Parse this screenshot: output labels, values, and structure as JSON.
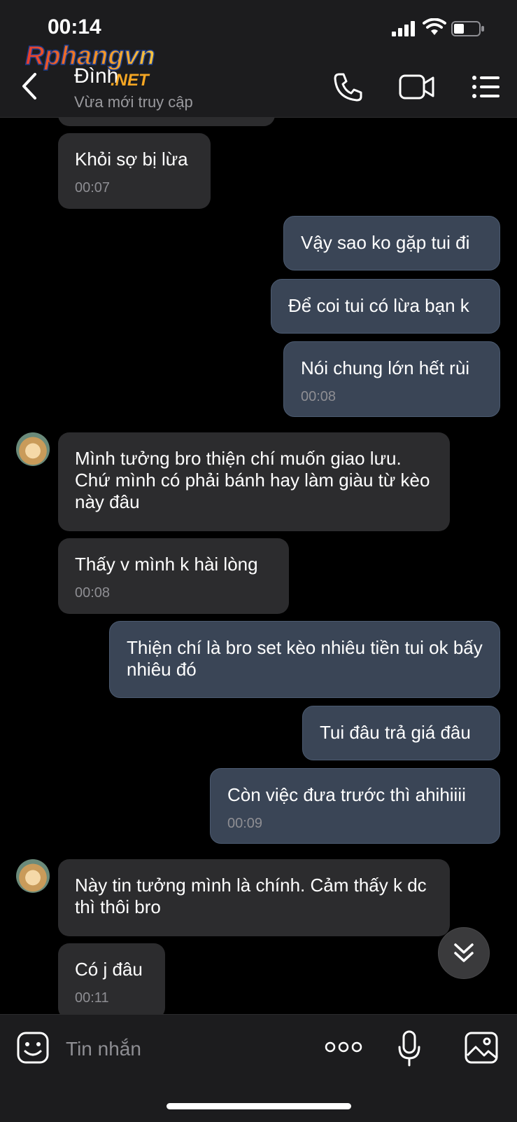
{
  "status_bar": {
    "time": "00:14"
  },
  "header": {
    "contact_name": "Đình",
    "contact_status": "Vừa mới truy cập",
    "watermark_text": "Rphangvn.NET"
  },
  "messages": [
    {
      "side": "in",
      "text": "Khỏi sợ bị lừa",
      "time": "00:07"
    },
    {
      "side": "out",
      "text": "Vậy sao ko gặp tui đi"
    },
    {
      "side": "out",
      "text": "Để coi tui có lừa bạn k"
    },
    {
      "side": "out",
      "text": "Nói chung lớn hết rùi",
      "time": "00:08"
    },
    {
      "side": "in",
      "text": "Mình tưởng bro thiện chí muốn giao lưu. Chứ mình có phải bánh hay làm giàu từ kèo này đâu"
    },
    {
      "side": "in",
      "text": "Thấy v mình k hài lòng",
      "time": "00:08"
    },
    {
      "side": "out",
      "text": "Thiện chí là bro set kèo nhiêu tiền tui ok bấy nhiêu đó"
    },
    {
      "side": "out",
      "text": "Tui đâu trả giá đâu"
    },
    {
      "side": "out",
      "text": "Còn việc đưa trước thì ahihiiii",
      "time": "00:09"
    },
    {
      "side": "in",
      "text": "Này tin tưởng mình là chính. Cảm thấy k dc thì thôi bro"
    },
    {
      "side": "in",
      "text": "Có j đâu",
      "time": "00:11"
    }
  ],
  "input": {
    "placeholder": "Tin nhắn"
  },
  "colors": {
    "background": "#000000",
    "incoming_bubble": "#2c2c2e",
    "outgoing_bubble": "#3a4556",
    "header": "#1c1c1e"
  },
  "icons": {
    "back": "chevron-left-icon",
    "call": "phone-icon",
    "video": "video-camera-icon",
    "menu": "list-menu-icon",
    "emoji": "sticker-icon",
    "more": "ellipsis-icon",
    "mic": "microphone-icon",
    "image": "image-icon",
    "scroll": "double-chevron-down-icon"
  }
}
